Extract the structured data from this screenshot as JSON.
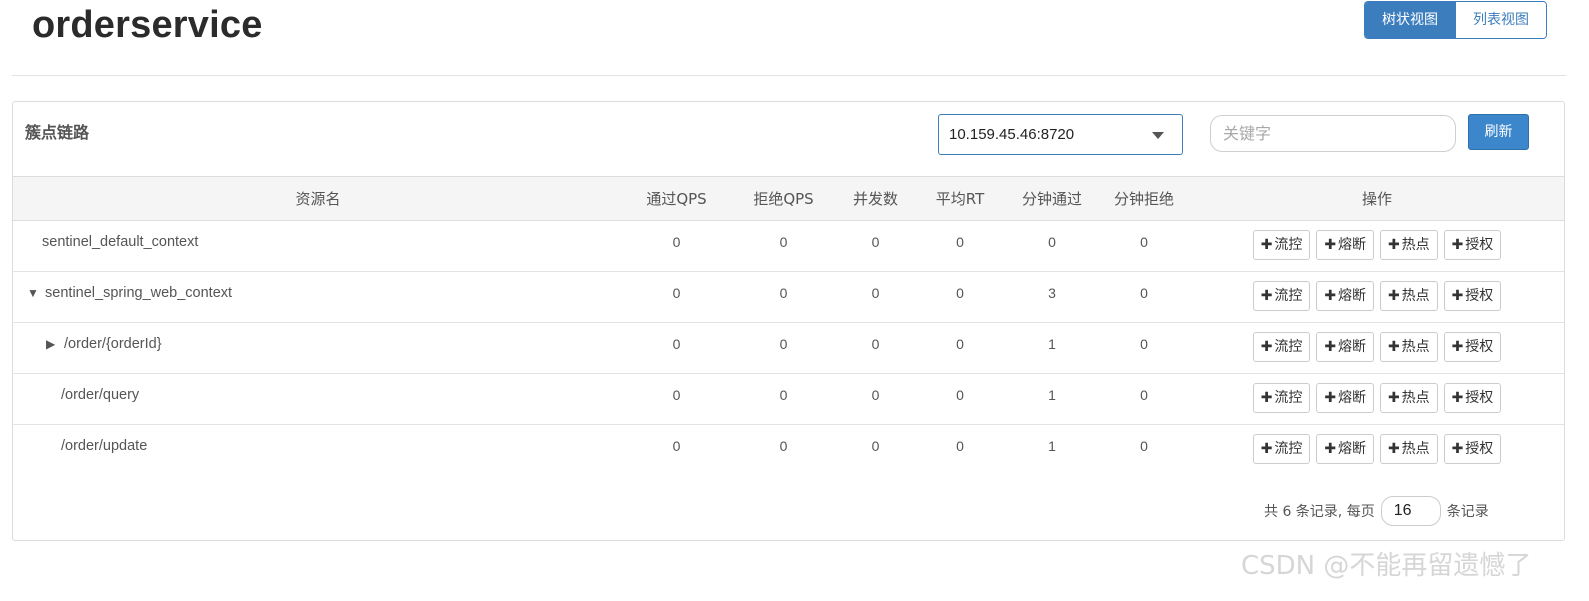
{
  "header": {
    "app_title": "orderservice",
    "view_tabs": [
      "树状视图",
      "列表视图"
    ]
  },
  "panel": {
    "title": "簇点链路",
    "machine": "10.159.45.46:8720",
    "search_placeholder": "关键字",
    "refresh_label": "刷新"
  },
  "table": {
    "columns": [
      "资源名",
      "通过QPS",
      "拒绝QPS",
      "并发数",
      "平均RT",
      "分钟通过",
      "分钟拒绝",
      "操作"
    ],
    "rows": [
      {
        "name": "sentinel_default_context",
        "toggle": "",
        "pass_qps": "0",
        "block_qps": "0",
        "threads": "0",
        "avg_rt": "0",
        "minute_pass": "0",
        "minute_block": "0"
      },
      {
        "name": "sentinel_spring_web_context",
        "toggle": "▼",
        "pass_qps": "0",
        "block_qps": "0",
        "threads": "0",
        "avg_rt": "0",
        "minute_pass": "3",
        "minute_block": "0"
      },
      {
        "name": "/order/{orderId}",
        "toggle": "▶",
        "pass_qps": "0",
        "block_qps": "0",
        "threads": "0",
        "avg_rt": "0",
        "minute_pass": "1",
        "minute_block": "0"
      },
      {
        "name": "/order/query",
        "toggle": "",
        "pass_qps": "0",
        "block_qps": "0",
        "threads": "0",
        "avg_rt": "0",
        "minute_pass": "1",
        "minute_block": "0"
      },
      {
        "name": "/order/update",
        "toggle": "",
        "pass_qps": "0",
        "block_qps": "0",
        "threads": "0",
        "avg_rt": "0",
        "minute_pass": "1",
        "minute_block": "0"
      }
    ],
    "op_buttons": [
      "流控",
      "熔断",
      "热点",
      "授权"
    ],
    "plus_glyph": "✚"
  },
  "pager": {
    "summary": "共 6 条记录, 每页",
    "page_size": "16",
    "suffix": "条记录"
  },
  "watermark": "CSDN @不能再留遗憾了",
  "colors": {
    "primary": "#3c7dbd",
    "refresh_button": "#3c86cc",
    "header_bg": "#f5f5f5"
  }
}
